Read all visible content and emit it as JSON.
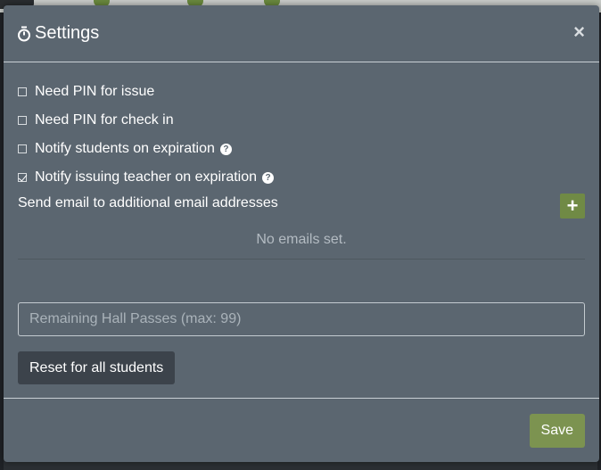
{
  "modal": {
    "title": "Settings",
    "title_icon": "stopwatch-icon",
    "close_symbol": "×",
    "options": [
      {
        "label": "Need PIN for issue",
        "checked": false,
        "help": false
      },
      {
        "label": "Need PIN for check in",
        "checked": false,
        "help": false
      },
      {
        "label": "Notify students on expiration",
        "checked": false,
        "help": true
      },
      {
        "label": "Notify issuing teacher on expiration",
        "checked": true,
        "help": true
      }
    ],
    "help_symbol": "?",
    "email_section": {
      "label": "Send email to additional email addresses",
      "add_symbol": "+",
      "empty_text": "No emails set."
    },
    "passes_input": {
      "placeholder": "Remaining Hall Passes (max: 99)",
      "value": ""
    },
    "reset_label": "Reset for all students",
    "save_label": "Save"
  },
  "colors": {
    "modal_bg": "#5b6670",
    "accent_green": "#7c9350",
    "dark_button": "#3c434b"
  }
}
